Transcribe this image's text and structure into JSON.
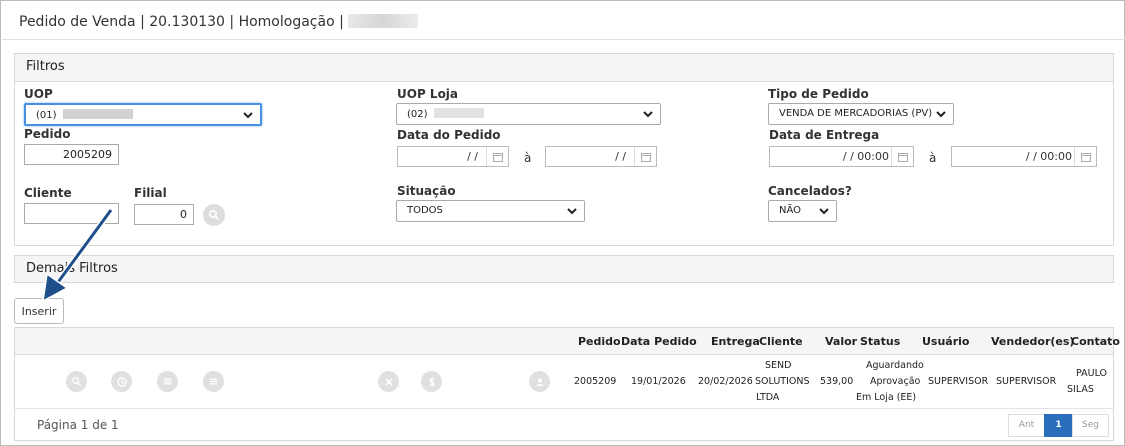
{
  "header": {
    "title": "Pedido de Venda | 20.130130 | Homologação |"
  },
  "filters": {
    "title": "Filtros",
    "uop": {
      "label": "UOP",
      "value": "(01)"
    },
    "uop_loja": {
      "label": "UOP Loja",
      "value": "(02)"
    },
    "tipo_pedido": {
      "label": "Tipo de Pedido",
      "value": "VENDA DE MERCADORIAS (PV)"
    },
    "pedido": {
      "label": "Pedido",
      "value": "2005209"
    },
    "data_pedido": {
      "label": "Data do Pedido",
      "from": "/ /",
      "to": "/ /",
      "sep": "à"
    },
    "data_entrega": {
      "label": "Data de Entrega",
      "from": "/ /       00:00",
      "to": "/ /       00:00",
      "sep": "à"
    },
    "cliente": {
      "label": "Cliente",
      "value": ""
    },
    "filial": {
      "label": "Filial",
      "value": "0"
    },
    "situacao": {
      "label": "Situação",
      "value": "TODOS"
    },
    "cancelados": {
      "label": "Cancelados?",
      "value": "NÃO"
    }
  },
  "more_filters": {
    "title": "Demais Filtros"
  },
  "toolbar": {
    "insert_label": "Inserir"
  },
  "grid": {
    "columns": {
      "pedido": "Pedido",
      "data_pedido": "Data Pedido",
      "entrega": "Entrega",
      "cliente": "Cliente",
      "valor": "Valor",
      "status": "Status",
      "usuario": "Usuário",
      "vendedores": "Vendedor(es)",
      "contato": "Contato"
    },
    "row": {
      "pedido": "2005209",
      "data_pedido": "19/01/2026",
      "entrega": "20/02/2026",
      "cliente": [
        "SEND",
        "SOLUTIONS",
        "LTDA"
      ],
      "valor": "539,00",
      "status": [
        "Aguardando",
        "Aprovação",
        "Em Loja (EE)"
      ],
      "usuario": "SUPERVISOR",
      "vendedores": "SUPERVISOR",
      "contato": [
        "PAULO",
        "SILAS"
      ]
    }
  },
  "pager": {
    "text": "Página 1 de 1",
    "prev": "Ant",
    "current": "1",
    "next": "Seg"
  },
  "colors": {
    "accent": "#2a6ebb",
    "focus": "#4a90e2",
    "annotation_arrow": "#1f4f8a"
  }
}
